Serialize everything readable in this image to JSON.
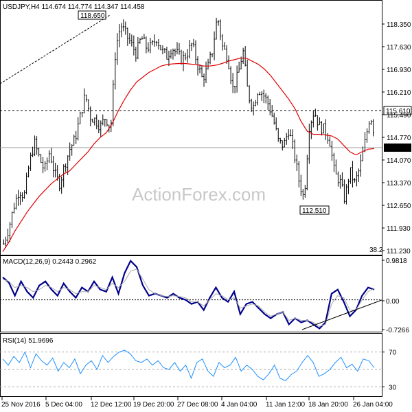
{
  "header": {
    "main": "USDJPY,H4  114.674 114.774 114.347 114.458",
    "macd": "MACD(12,26,9) 0.2443 0.2962",
    "rsi": "RSI(14) 51.9696"
  },
  "watermark": "ActionForex.com",
  "colors": {
    "candle": "#000000",
    "ma": "#e00000",
    "macd": "#00008b",
    "signal": "#a9a9a9",
    "grid": "#000000",
    "trend": "#000000",
    "label_fill": "#ffffff"
  },
  "chart_data": [
    {
      "type": "candlestick",
      "name": "price",
      "title": "USDJPY,H4",
      "ohlc_last": {
        "open": 114.674,
        "high": 114.774,
        "low": 114.347,
        "close": 114.458
      },
      "ylim": [
        11.23,
        118.65
      ],
      "yticks": [
        "118.350",
        "117.630",
        "116.930",
        "116.210",
        "115.490",
        "114.770",
        "114.070",
        "113.370",
        "112.650",
        "111.930",
        "111.230"
      ],
      "current_price_label": "114.458",
      "level_label": "115.610",
      "fib_label": "38.2",
      "annotations": [
        "118.650",
        "112.510"
      ],
      "xticks": [
        "25 Nov 2016",
        "5 Dec 04:00",
        "12 Dec 12:00",
        "19 Dec 20:00",
        "27 Dec 08:00",
        "4 Jan 04:00",
        "11 Jan 12:00",
        "18 Jan 20:00",
        "26 Jan 04:00"
      ],
      "moving_average": [
        111.05,
        111.35,
        111.7,
        112.0,
        112.3,
        112.55,
        112.8,
        113.0,
        113.2,
        113.35,
        113.5,
        113.6,
        113.8,
        114.0,
        114.2,
        114.45,
        114.65,
        114.8,
        115.1,
        115.5,
        115.85,
        116.15,
        116.4,
        116.55,
        116.7,
        116.8,
        116.9,
        116.95,
        116.97,
        116.98,
        116.98,
        116.96,
        116.94,
        116.9,
        116.9,
        116.93,
        116.98,
        117.05,
        117.1,
        117.15,
        117.15,
        117.05,
        116.95,
        116.8,
        116.6,
        116.35,
        116.1,
        115.85,
        115.55,
        115.15,
        114.85,
        114.75,
        114.75,
        114.73,
        114.7,
        114.6,
        114.4,
        114.2,
        114.1,
        114.2,
        114.28,
        114.3
      ],
      "price_path": [
        111.3,
        111.8,
        112.5,
        113.0,
        112.8,
        113.8,
        114.5,
        114.0,
        113.6,
        114.2,
        113.5,
        113.2,
        113.8,
        114.3,
        114.6,
        115.3,
        116.0,
        115.3,
        115.2,
        115.0,
        115.3,
        114.9,
        117.5,
        118.2,
        117.9,
        117.6,
        117.3,
        117.8,
        117.5,
        117.5,
        117.8,
        117.4,
        117.2,
        117.5,
        117.3,
        117.1,
        117.3,
        117.6,
        117.0,
        116.5,
        116.8,
        117.4,
        118.5,
        117.5,
        117.2,
        116.2,
        116.6,
        117.4,
        116.0,
        115.6,
        116.2,
        116.0,
        115.7,
        115.2,
        114.5,
        114.4,
        114.9,
        114.2,
        113.3,
        112.7,
        115.0,
        115.5,
        115.0,
        114.9,
        114.6,
        113.5,
        113.3,
        112.7,
        113.6,
        113.2,
        113.7,
        114.5,
        115.4,
        114.6
      ]
    },
    {
      "type": "line",
      "name": "MACD(12,26,9)",
      "values_header": [
        0.2443,
        0.2962
      ],
      "ylim": [
        -0.7266,
        0.9818
      ],
      "yticks": [
        "0.9818",
        "0.00",
        "-0.7266"
      ],
      "series": [
        {
          "name": "MACD",
          "values": [
            0.55,
            0.42,
            0.1,
            0.45,
            0.2,
            0.05,
            0.35,
            0.45,
            0.25,
            0.1,
            0.4,
            0.2,
            0.05,
            0.3,
            0.2,
            0.45,
            0.25,
            0.2,
            0.55,
            0.15,
            0.65,
            0.95,
            0.8,
            0.35,
            0.1,
            0.15,
            0.1,
            0.05,
            0.15,
            0.05,
            0.0,
            -0.1,
            -0.05,
            -0.25,
            0.05,
            0.3,
            0.05,
            -0.05,
            0.2,
            -0.35,
            -0.1,
            -0.05,
            -0.2,
            -0.35,
            -0.45,
            -0.35,
            -0.3,
            -0.6,
            -0.45,
            -0.55,
            -0.5,
            -0.6,
            -0.7,
            -0.55,
            0.15,
            0.25,
            -0.05,
            -0.4,
            -0.25,
            0.1,
            0.3,
            0.25
          ]
        },
        {
          "name": "Signal",
          "values": [
            0.5,
            0.45,
            0.3,
            0.35,
            0.3,
            0.2,
            0.25,
            0.35,
            0.3,
            0.2,
            0.3,
            0.25,
            0.15,
            0.2,
            0.2,
            0.35,
            0.3,
            0.25,
            0.4,
            0.3,
            0.45,
            0.7,
            0.75,
            0.5,
            0.25,
            0.15,
            0.1,
            0.08,
            0.1,
            0.08,
            0.05,
            -0.05,
            -0.05,
            -0.15,
            0.0,
            0.15,
            0.1,
            0.0,
            0.05,
            -0.2,
            -0.15,
            -0.1,
            -0.15,
            -0.3,
            -0.4,
            -0.35,
            -0.3,
            -0.5,
            -0.45,
            -0.5,
            -0.5,
            -0.55,
            -0.65,
            -0.6,
            -0.1,
            0.1,
            0.05,
            -0.25,
            -0.25,
            0.0,
            0.2,
            0.28
          ]
        }
      ],
      "trend_line": true
    },
    {
      "type": "line",
      "name": "RSI(14)",
      "value_header": 51.9696,
      "ylim": [
        30,
        70
      ],
      "yticks": [
        "70",
        "30"
      ],
      "levels": [
        70,
        50,
        30
      ],
      "values": [
        62,
        55,
        65,
        58,
        70,
        52,
        68,
        60,
        55,
        63,
        48,
        58,
        52,
        62,
        45,
        55,
        60,
        50,
        66,
        58,
        65,
        70,
        72,
        68,
        60,
        58,
        62,
        55,
        60,
        52,
        50,
        58,
        48,
        55,
        40,
        58,
        62,
        48,
        42,
        58,
        52,
        55,
        64,
        48,
        55,
        50,
        42,
        38,
        45,
        55,
        40,
        37,
        44,
        48,
        58,
        66,
        58,
        42,
        45,
        50,
        58,
        64,
        52,
        56,
        48,
        62,
        60,
        52
      ]
    }
  ]
}
